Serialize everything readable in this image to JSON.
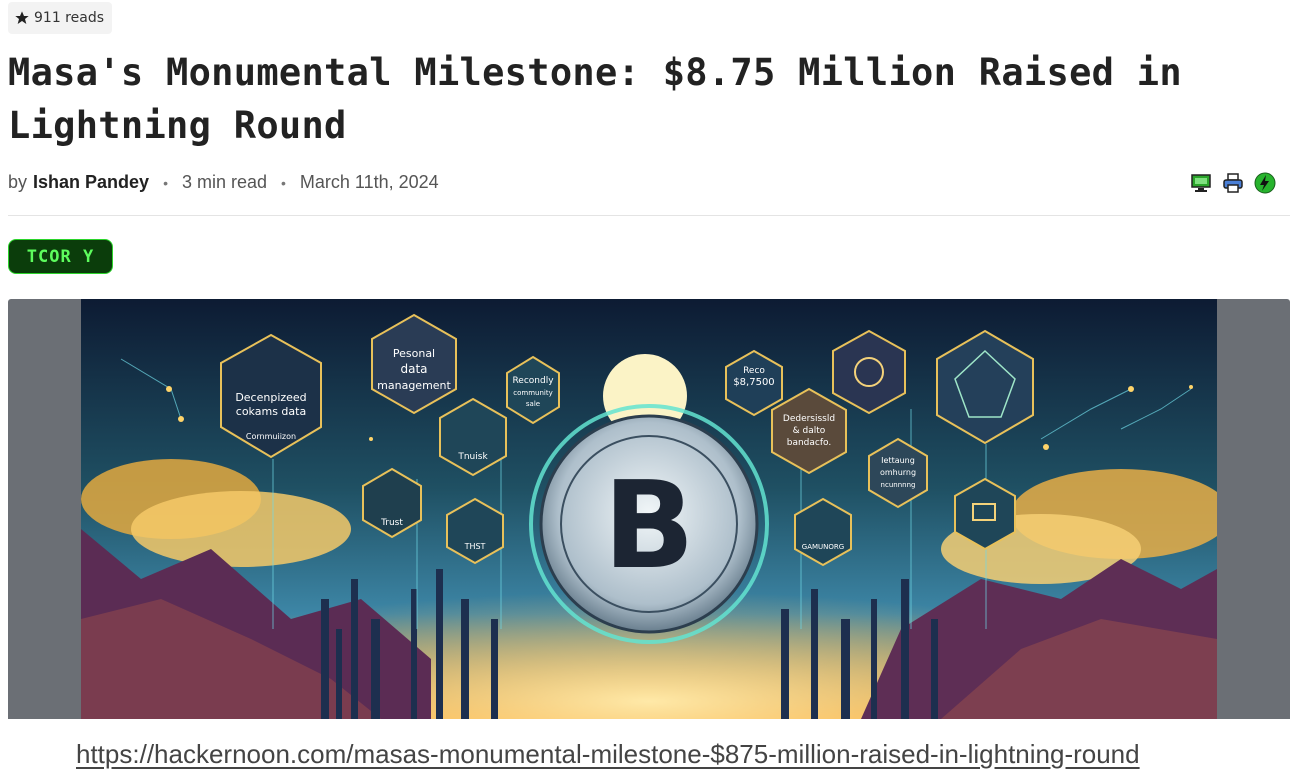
{
  "meta": {
    "reads": "911 reads"
  },
  "article": {
    "title": "Masa's Monumental Milestone: $8.75 Million Raised in Lightning Round",
    "by_prefix": "by",
    "author": "Ishan Pandey",
    "read_time": "3 min read",
    "date": "March 11th, 2024"
  },
  "toolbar_icons": [
    "computer-icon",
    "printer-icon",
    "lightning-icon"
  ],
  "tag": "TCOR Y",
  "hero_labels": {
    "hex1_line1": "Decenpizeed",
    "hex1_line2": "cokams data",
    "hex1_line3": "Cornmuiizon",
    "hex2_line1": "Pesonal",
    "hex2_line2": "data",
    "hex2_line3": "management",
    "hex3_line1": "Recondly",
    "hex3_line2": "community",
    "hex3_line3": "sale",
    "hex4": "Tnuisk",
    "hex5": "Trust",
    "hex6": "THST",
    "hex7_line1": "Reco",
    "hex7_line2": "$8,7500",
    "hex8_line1": "Dedersissld",
    "hex8_line2": "& dalto",
    "hex8_line3": "bandacfo.",
    "hex9_line1": "Iettaung",
    "hex9_line2": "omhurng",
    "hex9_line3": "ncunnnng",
    "hex10": "GAMUNORG",
    "coin_symbol": "B"
  },
  "footer": {
    "url": "https://hackernoon.com/masas-monumental-milestone-$875-million-raised-in-lightning-round"
  }
}
